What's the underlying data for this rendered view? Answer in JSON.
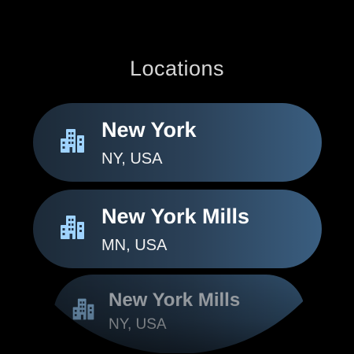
{
  "header": {
    "title": "Locations"
  },
  "locations": [
    {
      "name": "New York",
      "region": "NY, USA",
      "icon": "city-building-icon"
    },
    {
      "name": "New York Mills",
      "region": "MN, USA",
      "icon": "city-building-icon"
    },
    {
      "name": "New York Mills",
      "region": "NY, USA",
      "icon": "city-building-icon"
    }
  ],
  "colors": {
    "background": "#000000",
    "chip_start": "#1c2a38",
    "chip_end": "#3a5e80",
    "icon": "#9fd3ff",
    "title": "#d6d6d6"
  }
}
